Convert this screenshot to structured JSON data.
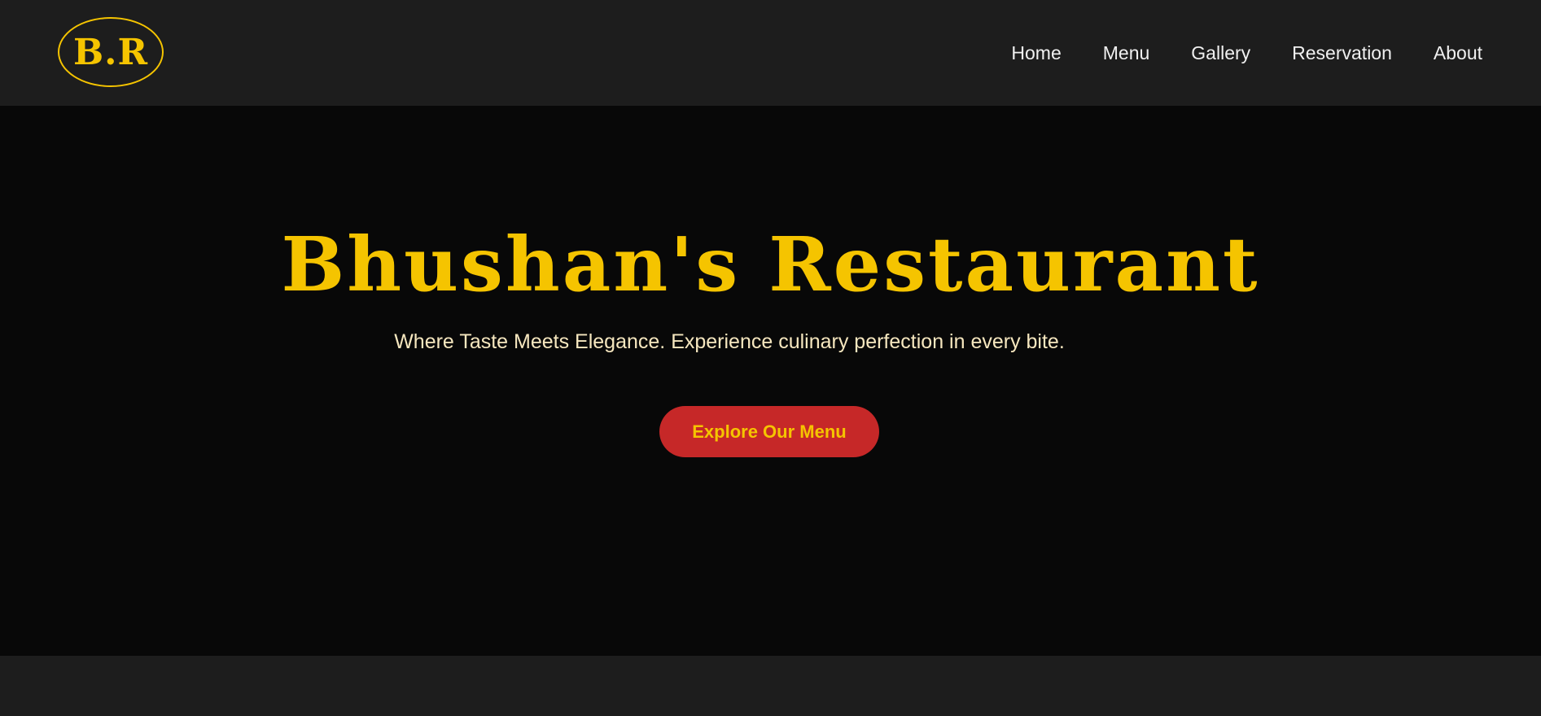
{
  "header": {
    "logo_text": "B.R",
    "nav": [
      {
        "label": "Home"
      },
      {
        "label": "Menu"
      },
      {
        "label": "Gallery"
      },
      {
        "label": "Reservation"
      },
      {
        "label": "About"
      }
    ]
  },
  "hero": {
    "title": "Bhushan's Restaurant",
    "subtitle": "Where Taste Meets Elegance. Experience culinary perfection in every bite.",
    "cta_label": "Explore Our Menu"
  },
  "colors": {
    "accent": "#f5c400",
    "button": "#c62828",
    "header_bg": "#1d1d1d",
    "hero_bg": "#080808"
  }
}
